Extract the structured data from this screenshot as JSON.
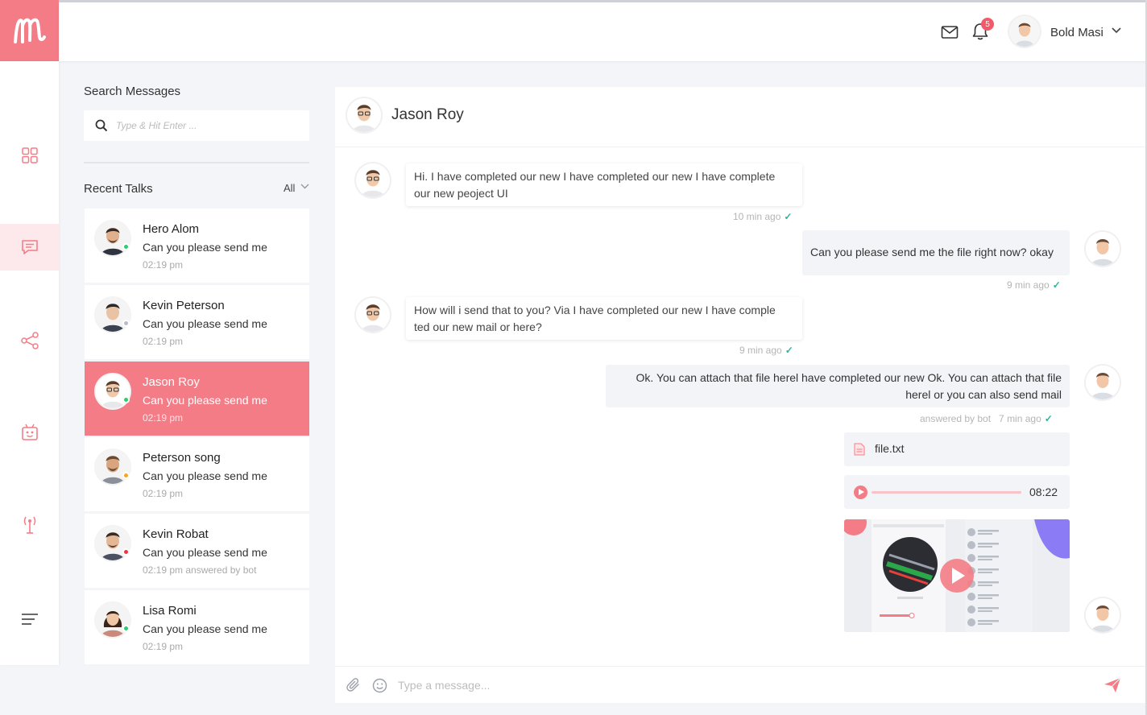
{
  "brand": {
    "accent": "#f47c86",
    "logo_icon": "m-logo-icon"
  },
  "header": {
    "mail_icon": "envelope-icon",
    "bell_icon": "bell-icon",
    "notification_count": "5",
    "user_name": "Bold Masi",
    "user_menu_icon": "chevron-down-icon"
  },
  "nav": {
    "items": [
      {
        "icon": "grid-icon"
      },
      {
        "icon": "chat-icon",
        "active": true
      },
      {
        "icon": "share-icon"
      },
      {
        "icon": "robot-icon"
      },
      {
        "icon": "antenna-icon"
      },
      {
        "icon": "menu-lines-icon"
      }
    ]
  },
  "sidebar": {
    "search_label": "Search Messages",
    "search_placeholder": "Type & Hit Enter ...",
    "recent_label": "Recent Talks",
    "filter_label": "All",
    "talks": [
      {
        "name": "Hero Alom",
        "message": "Can you please send me",
        "time": "02:19 pm",
        "status_color": "#2ecc71"
      },
      {
        "name": "Kevin Peterson",
        "message": "Can you please send me",
        "time": "02:19 pm",
        "status_color": "#b8bcc4"
      },
      {
        "name": "Jason Roy",
        "message": "Can you please send me",
        "time": "02:19 pm",
        "status_color": "#2ecc71",
        "active": true
      },
      {
        "name": "Peterson song",
        "message": "Can you please send me",
        "time": "02:19 pm",
        "status_color": "#f5a623"
      },
      {
        "name": "Kevin Robat",
        "message": "Can you please send me",
        "time": "02:19 pm   answered by bot",
        "status_color": "#ee3344"
      },
      {
        "name": "Lisa Romi",
        "message": "Can you please send me",
        "time": "02:19 pm",
        "status_color": "#2ecc71"
      }
    ]
  },
  "chat": {
    "contact_name": "Jason Roy",
    "messages": [
      {
        "dir": "in",
        "lines": [
          "Hi. I have completed our new I have completed our new I have complete",
          "our new peoject UI"
        ],
        "meta": "10 min ago"
      },
      {
        "dir": "out",
        "lines": [
          "Can you please send me the file right now? okay"
        ],
        "meta": "9 min ago"
      },
      {
        "dir": "in",
        "lines": [
          "How will i send that to you? Via I have completed our new I have comple",
          "ted our new mail or here?"
        ],
        "meta": "9 min ago"
      },
      {
        "dir": "out",
        "lines": [
          "Ok. You can attach that file herel have completed our new Ok. You can attach that file",
          "herel or you can also send mail"
        ],
        "meta": "answered by bot   7 min ago"
      }
    ],
    "file_name": "file.txt",
    "file_icon": "document-icon",
    "audio_time": "08:22",
    "audio_progress": 0.0,
    "compose_placeholder": "Type a message...",
    "attach_icon": "paperclip-icon",
    "emoji_icon": "smiley-icon",
    "send_icon": "send-icon"
  }
}
